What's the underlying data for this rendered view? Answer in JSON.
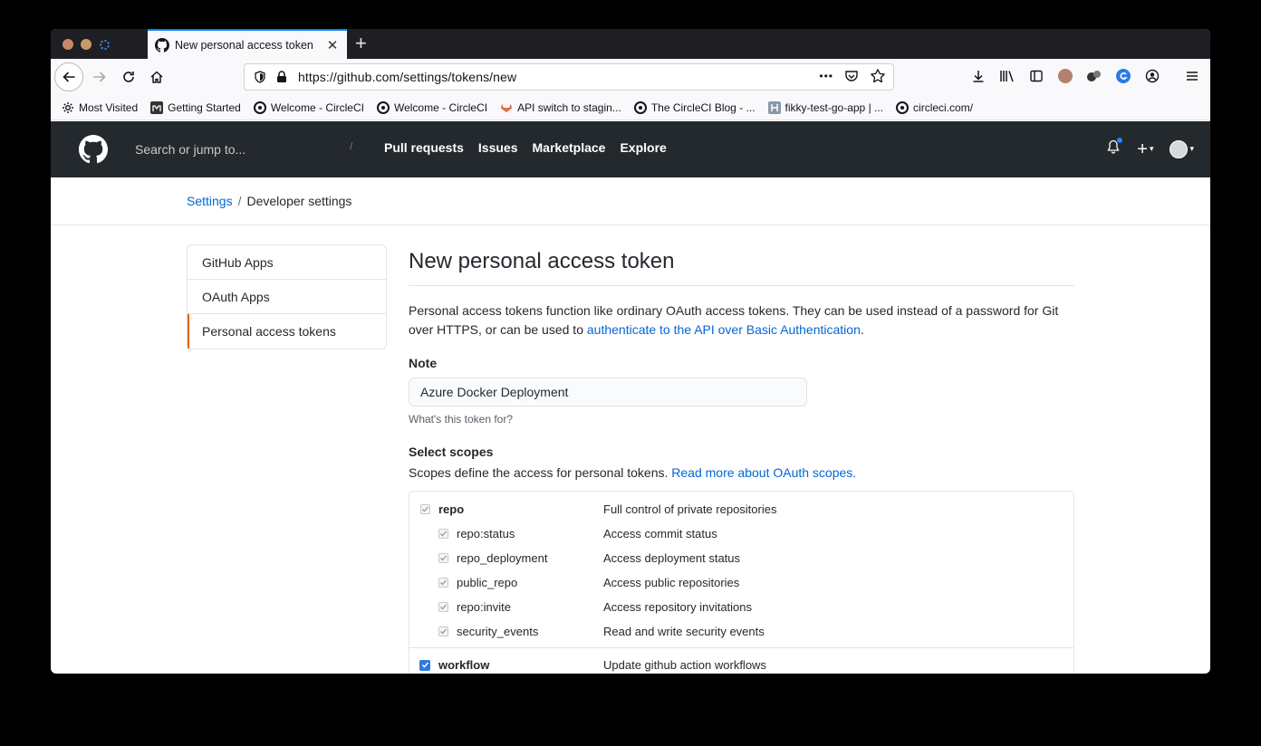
{
  "browser": {
    "tab": {
      "title": "New personal access token",
      "close": "✕"
    },
    "new_tab": "+",
    "url": "https://github.com/settings/tokens/new",
    "url_more": "•••",
    "bookmarks": [
      {
        "label": "Most Visited",
        "icon": "gear-icon"
      },
      {
        "label": "Getting Started",
        "icon": "m-logo-icon"
      },
      {
        "label": "Welcome - CircleCI",
        "icon": "circleci-icon"
      },
      {
        "label": "Welcome - CircleCI",
        "icon": "circleci-icon"
      },
      {
        "label": "API switch to stagin...",
        "icon": "gitlab-icon"
      },
      {
        "label": "The CircleCI Blog - ...",
        "icon": "circleci-icon"
      },
      {
        "label": "fikky-test-go-app | ...",
        "icon": "app-icon"
      },
      {
        "label": "circleci.com/",
        "icon": "circleci-icon"
      }
    ]
  },
  "github": {
    "search_placeholder": "Search or jump to...",
    "search_shortcut": "/",
    "nav": [
      "Pull requests",
      "Issues",
      "Marketplace",
      "Explore"
    ],
    "plus": "+",
    "caret": "▾"
  },
  "breadcrumb": {
    "root": "Settings",
    "sep": "/",
    "current": "Developer settings"
  },
  "sidebar": {
    "items": [
      {
        "label": "GitHub Apps"
      },
      {
        "label": "OAuth Apps"
      },
      {
        "label": "Personal access tokens"
      }
    ]
  },
  "main": {
    "title": "New personal access token",
    "intro_text": "Personal access tokens function like ordinary OAuth access tokens. They can be used instead of a password for Git over HTTPS, or can be used to ",
    "intro_link": "authenticate to the API over Basic Authentication",
    "intro_end": ".",
    "note_label": "Note",
    "note_value": "Azure Docker Deployment",
    "note_hint": "What's this token for?",
    "scopes_label": "Select scopes",
    "scopes_desc": "Scopes define the access for personal tokens. ",
    "scopes_link": "Read more about OAuth scopes.",
    "scopes": [
      {
        "name": "repo",
        "desc": "Full control of private repositories",
        "parent": true
      },
      {
        "name": "repo:status",
        "desc": "Access commit status"
      },
      {
        "name": "repo_deployment",
        "desc": "Access deployment status"
      },
      {
        "name": "public_repo",
        "desc": "Access public repositories"
      },
      {
        "name": "repo:invite",
        "desc": "Access repository invitations"
      },
      {
        "name": "security_events",
        "desc": "Read and write security events"
      },
      {
        "name": "workflow",
        "desc": "Update github action workflows",
        "parent": true
      }
    ]
  },
  "colors": {
    "link": "#0366d6",
    "header": "#24292e",
    "accent": "#e36209",
    "check": "#2c7be5"
  }
}
